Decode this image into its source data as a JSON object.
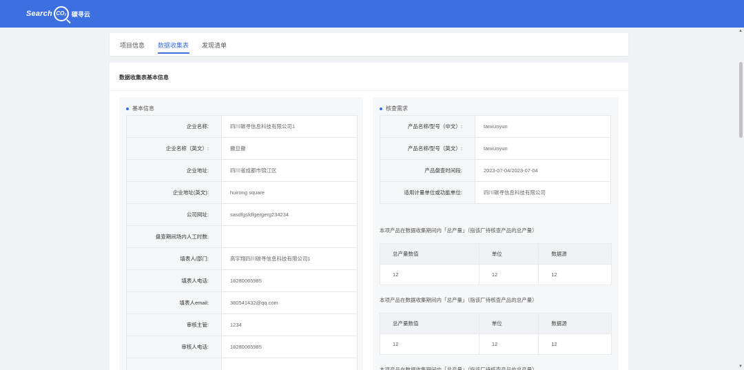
{
  "brand": {
    "search": "Search",
    "co2": "CO₂",
    "cn": "碳寻云"
  },
  "tabs": [
    "项目信息",
    "数据收集表",
    "发现清单"
  ],
  "main_title": "数据收集表基本信息",
  "left_section": {
    "title": "基本信息",
    "rows": [
      {
        "k": "企业名称:",
        "v": "四川碳寻信息科技有限公司1"
      },
      {
        "k": "企业名称（英文）:",
        "v": "撒旦撒"
      },
      {
        "k": "企业地址:",
        "v": "四川省成都市锦江区"
      },
      {
        "k": "企业地址(英文):",
        "v": "huirong square"
      },
      {
        "k": "公司网址:",
        "v": "sasdfgsfdfgergerg234234"
      },
      {
        "k": "盘查期间场内人工时数:",
        "v": ""
      },
      {
        "k": "填表人/部门:",
        "v": "高宇翔四川碳寻信息科技有限公司1"
      },
      {
        "k": "填表人电话:",
        "v": "18280065985"
      },
      {
        "k": "填表人email:",
        "v": "380541432@qq.com"
      },
      {
        "k": "审核主管:",
        "v": "1234"
      },
      {
        "k": "审核人电话:",
        "v": "18280065985"
      },
      {
        "k": "",
        "v": ""
      }
    ]
  },
  "right_section": {
    "title": "核查需求",
    "rows": [
      {
        "k": "产品名称/型号（中文）:",
        "v": "tanxunyun"
      },
      {
        "k": "产品名称/型号（英文）:",
        "v": "tanxunyun"
      },
      {
        "k": "产品盘查时间段:",
        "v": "2023-07-04/2023-07-04"
      },
      {
        "k": "适用计量单位或功能单位:",
        "v": "四川碳寻信息科技有限公司"
      }
    ],
    "note": "本项产品在数据收集期间内「总产量」（指该厂待核查产品的总产量）",
    "table_headers": [
      "总产量数值",
      "单位",
      "数据源"
    ],
    "table_row": [
      "12",
      "12",
      "12"
    ]
  }
}
